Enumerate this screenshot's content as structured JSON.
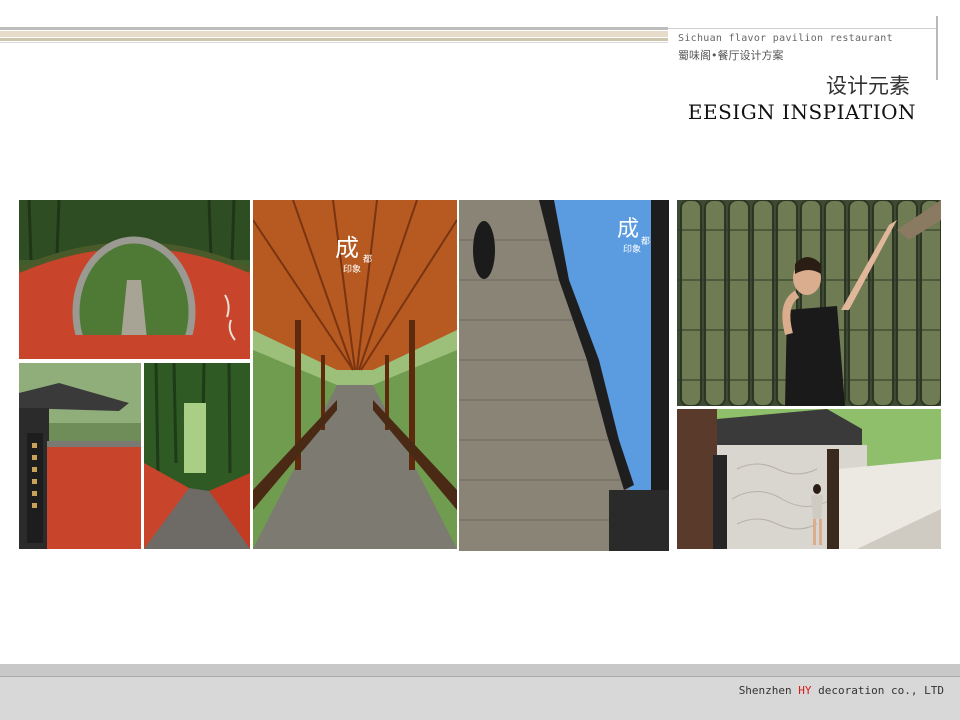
{
  "header": {
    "subtitle_en": "Sichuan flavor pavilion restaurant",
    "subtitle_zh": "蜀味阁•餐厅设计方案",
    "title_zh": "设计元素",
    "title_en": "EESIGN INSPIATION"
  },
  "photos": {
    "moon_gate": {
      "caption": ""
    },
    "long_corridor": {
      "stamp_char": "成",
      "stamp_small": "印象",
      "stamp_side": "都"
    },
    "brick_wall": {
      "stamp_char": "成",
      "stamp_small": "印象",
      "stamp_side": "都"
    }
  },
  "footer": {
    "company_prefix": "Shenzhen ",
    "company_highlight": "HY",
    "company_suffix": " decoration co., LTD"
  },
  "colors": {
    "accent": "#d81b1b",
    "red_wall": "#c8442a",
    "bamboo_green": "#3f6b2f",
    "sky_blue": "#5b9be0"
  }
}
